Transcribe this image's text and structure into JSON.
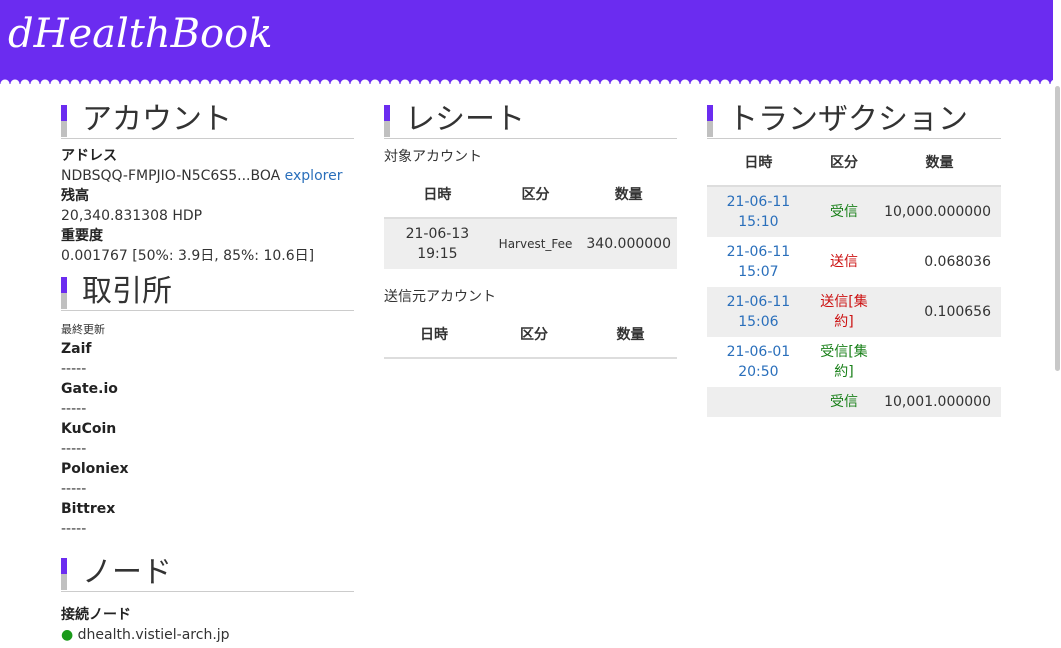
{
  "header": {
    "logo": "dHealthBook"
  },
  "account": {
    "title": "アカウント",
    "address_label": "アドレス",
    "address": "NDBSQQ-FMPJIO-N5C6S5...BOA",
    "explorer_link": "explorer",
    "balance_label": "残高",
    "balance": "20,340.831308 HDP",
    "importance_label": "重要度",
    "importance": "0.001767 [50%: 3.9日, 85%: 10.6日]"
  },
  "exchange": {
    "title": "取引所",
    "last_updated": "最終更新",
    "items": [
      {
        "name": "Zaif",
        "value": "-----"
      },
      {
        "name": "Gate.io",
        "value": "-----"
      },
      {
        "name": "KuCoin",
        "value": "-----"
      },
      {
        "name": "Poloniex",
        "value": "-----"
      },
      {
        "name": "Bittrex",
        "value": "-----"
      }
    ]
  },
  "node": {
    "title": "ノード",
    "connected_label": "接続ノード",
    "status_dot": "●",
    "host": "dhealth.vistiel-arch.jp"
  },
  "receipt": {
    "title": "レシート",
    "target_label": "対象アカウント",
    "columns": [
      "日時",
      "区分",
      "数量"
    ],
    "rows": [
      {
        "date": "21-06-13",
        "time": "19:15",
        "type": "Harvest_Fee",
        "amount": "340.000000"
      }
    ],
    "sender_label": "送信元アカウント",
    "sender_columns": [
      "日時",
      "区分",
      "数量"
    ]
  },
  "transactions": {
    "title": "トランザクション",
    "columns": [
      "日時",
      "区分",
      "数量"
    ],
    "rows": [
      {
        "date": "21-06-11",
        "time": "15:10",
        "type": "受信",
        "amount": "10,000.000000"
      },
      {
        "date": "21-06-11",
        "time": "15:07",
        "type": "送信",
        "amount": "0.068036"
      },
      {
        "date": "21-06-11",
        "time": "15:06",
        "type_1": "送信[集",
        "type_2": "約]",
        "amount": "0.100656"
      },
      {
        "date": "21-06-01",
        "time": "20:50",
        "type_1": "受信[集",
        "type_2": "約]",
        "amount": ""
      },
      {
        "date": "",
        "time": "",
        "type": "受信",
        "amount": "10,001.000000"
      }
    ]
  },
  "colors": {
    "header_bg": "#6b2cf0",
    "receive": "#198019",
    "send": "#cc1111",
    "link": "#2a6fbb"
  }
}
